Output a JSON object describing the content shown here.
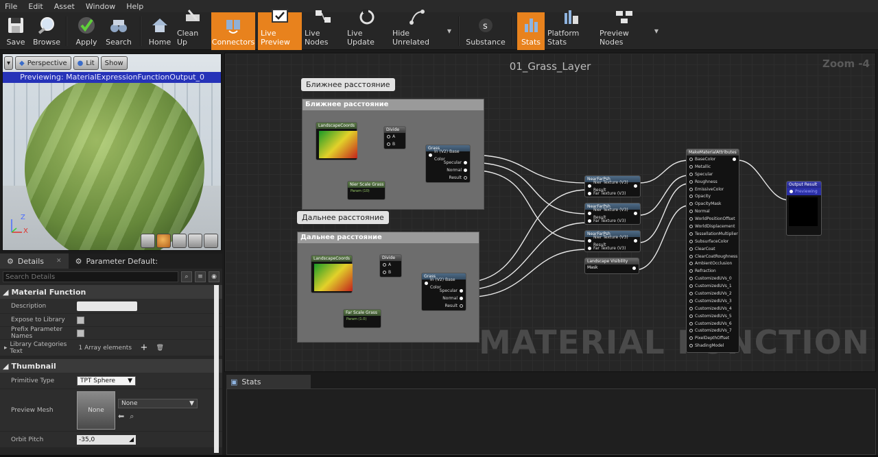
{
  "menu": [
    "File",
    "Edit",
    "Asset",
    "Window",
    "Help"
  ],
  "toolbar": [
    {
      "label": "Save",
      "icon": "save-icon",
      "active": false
    },
    {
      "label": "Browse",
      "icon": "magnifier-icon",
      "active": false
    },
    {
      "label": "Apply",
      "icon": "checkmark-icon",
      "active": false
    },
    {
      "label": "Search",
      "icon": "binoculars-icon",
      "active": false
    },
    {
      "label": "Home",
      "icon": "home-icon",
      "active": false
    },
    {
      "label": "Clean Up",
      "icon": "broom-icon",
      "active": false
    },
    {
      "label": "Connectors",
      "icon": "connectors-icon",
      "active": true
    },
    {
      "label": "Live Preview",
      "icon": "monitor-icon",
      "active": true
    },
    {
      "label": "Live Nodes",
      "icon": "nodes-icon",
      "active": false
    },
    {
      "label": "Live Update",
      "icon": "refresh-icon",
      "active": false
    },
    {
      "label": "Hide Unrelated",
      "icon": "graph-icon",
      "active": false
    },
    {
      "label": "Substance",
      "icon": "substance-icon",
      "active": false
    },
    {
      "label": "Stats",
      "icon": "bars-icon",
      "active": true
    },
    {
      "label": "Platform Stats",
      "icon": "platform-icon",
      "active": false
    },
    {
      "label": "Preview Nodes",
      "icon": "preview-nodes-icon",
      "active": false
    }
  ],
  "viewport": {
    "perspective": "Perspective",
    "lit": "Lit",
    "show": "Show",
    "previewing": "Previewing: MaterialExpressionFunctionOutput_0",
    "axis_z": "Z",
    "axis_x": "X"
  },
  "details": {
    "tab_details": "Details",
    "tab_params": "Parameter Default:",
    "search_placeholder": "Search Details",
    "section_material_function": "Material Function",
    "description": "Description",
    "expose": "Expose to Library",
    "prefix": "Prefix Parameter Names",
    "library_categories": "Library Categories Text",
    "array_elements": "1 Array elements",
    "section_thumbnail": "Thumbnail",
    "primitive_type": "Primitive Type",
    "primitive_value": "TPT Sphere",
    "preview_mesh": "Preview Mesh",
    "mesh_none": "None",
    "mesh_combo": "None",
    "orbit_pitch": "Orbit Pitch",
    "orbit_value": "-35,0"
  },
  "graph": {
    "title": "01_Grass_Layer",
    "zoom": "Zoom -4",
    "watermark": "MATERIAL FUNCTION",
    "bubble_near": "Ближнее расстояние",
    "comment_near": "Ближнее расстояние",
    "bubble_far": "Дальнее расстояние",
    "comment_far": "Дальнее расстояние",
    "landscape_coords": "LandscapeCoords",
    "divide": "Divide",
    "pin_a": "A",
    "pin_b": "B",
    "grass": "Grass",
    "grass_in": "In (V2) Base Color",
    "specular": "Specular",
    "normal": "Normal",
    "result": "Result",
    "near_scale": "Nier Scale Grass",
    "near_scale_val": "Param (10)",
    "far_scale": "Far Scale Grass",
    "far_scale_val": "Param (1.0)",
    "nearfar": "NearFarPsh",
    "nier_tex": "Nier Texture (V3) Result",
    "far_tex": "Far Texture (V3)",
    "visibility": "Landscape Visibility Mask",
    "make_attr": "MakeMaterialAttributes",
    "attributes": [
      "BaseColor",
      "Metallic",
      "Specular",
      "Roughness",
      "EmissiveColor",
      "Opacity",
      "OpacityMask",
      "Normal",
      "WorldPositionOffset",
      "WorldDisplacement",
      "TessellationMultiplier",
      "SubsurfaceColor",
      "ClearCoat",
      "ClearCoatRoughness",
      "AmbientOcclusion",
      "Refraction",
      "CustomizedUVs_0",
      "CustomizedUVs_1",
      "CustomizedUVs_2",
      "CustomizedUVs_3",
      "CustomizedUVs_4",
      "CustomizedUVs_5",
      "CustomizedUVs_6",
      "CustomizedUVs_7",
      "PixelDepthOffset",
      "ShadingModel"
    ],
    "output": "Output Result",
    "output_sub": "Previewing"
  },
  "stats": {
    "tab": "Stats"
  },
  "colors": {
    "accent": "#e8821d",
    "preview_bar": "#2633b8"
  }
}
